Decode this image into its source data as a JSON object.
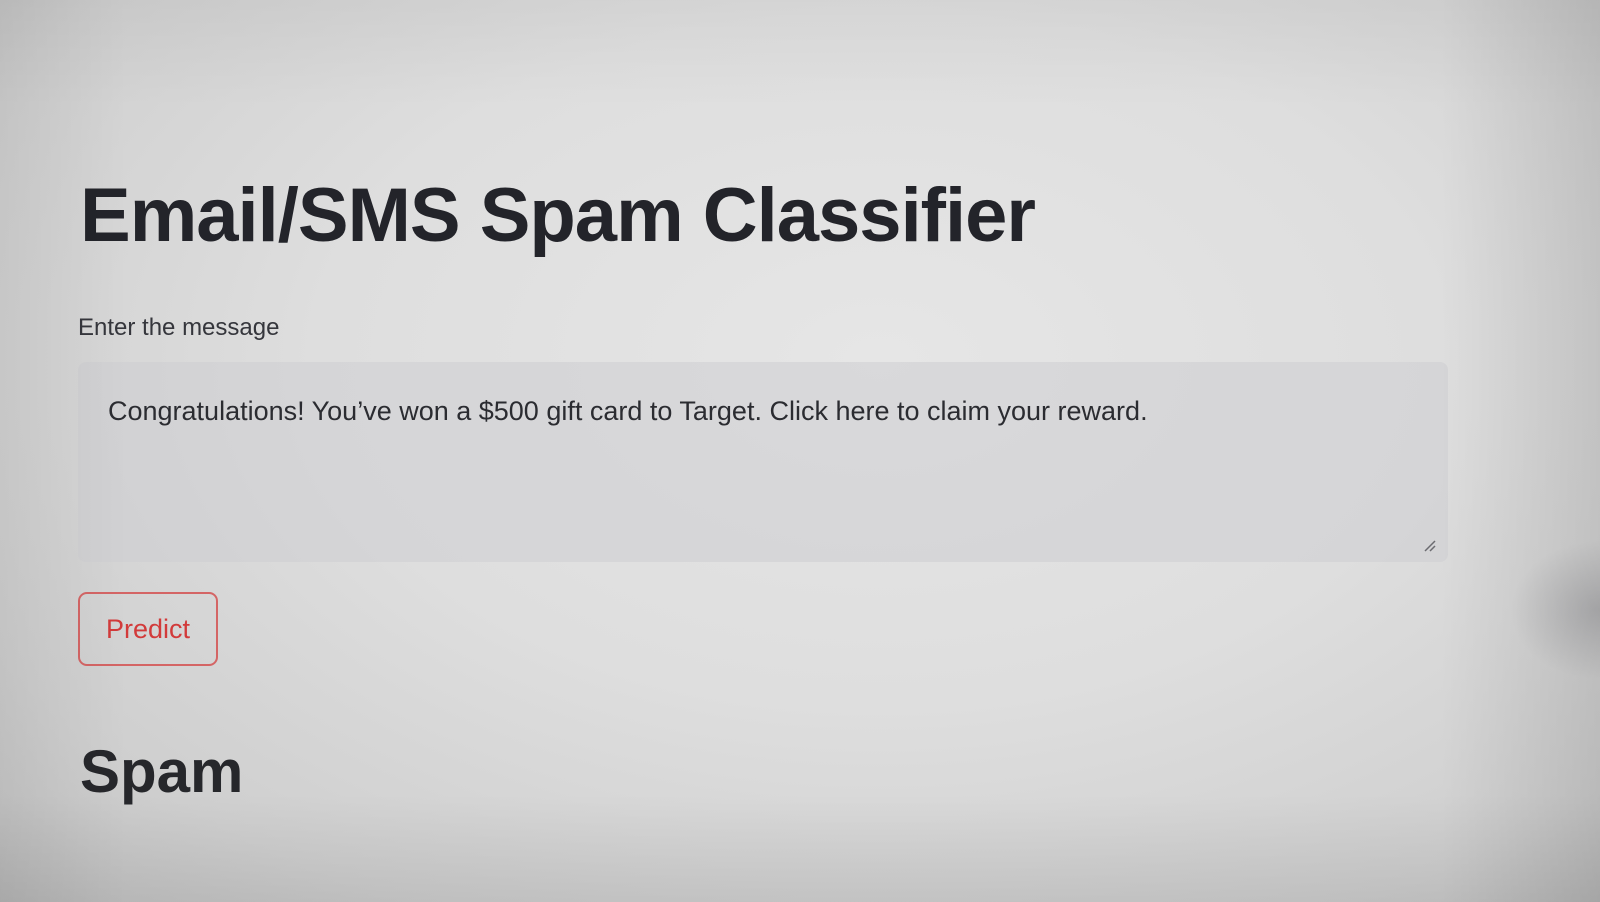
{
  "app": {
    "title": "Email/SMS Spam Classifier"
  },
  "input": {
    "label": "Enter the message",
    "value": "Congratulations! You’ve won a $500 gift card to Target. Click here to claim your reward.",
    "resize_icon": "resize-handle-icon"
  },
  "actions": {
    "predict_label": "Predict"
  },
  "result": {
    "text": "Spam"
  },
  "colors": {
    "accent": "#d23a3a",
    "text": "#26272b",
    "field_background": "#cdced2"
  }
}
